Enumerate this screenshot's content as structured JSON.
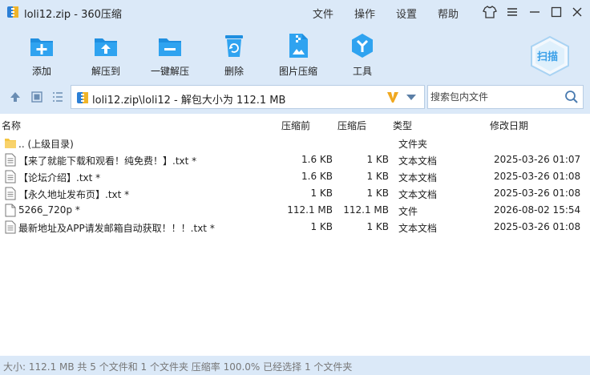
{
  "window": {
    "title": "loli12.zip - 360压缩",
    "menu": [
      "文件",
      "操作",
      "设置",
      "帮助"
    ]
  },
  "toolbar": {
    "items": [
      {
        "label": "添加",
        "icon": "add-icon"
      },
      {
        "label": "解压到",
        "icon": "extract-to-icon"
      },
      {
        "label": "一键解压",
        "icon": "one-click-extract-icon"
      },
      {
        "label": "删除",
        "icon": "delete-icon"
      },
      {
        "label": "图片压缩",
        "icon": "image-compress-icon"
      },
      {
        "label": "工具",
        "icon": "tools-icon"
      }
    ],
    "scan_label": "扫描"
  },
  "address": {
    "path": "loli12.zip\\loli12 - 解包大小为 112.1 MB"
  },
  "search": {
    "placeholder": "搜索包内文件"
  },
  "columns": {
    "name": "名称",
    "before": "压缩前",
    "after": "压缩后",
    "type": "类型",
    "modified": "修改日期"
  },
  "files": [
    {
      "name": ".. (上级目录)",
      "before": "",
      "after": "",
      "type": "文件夹",
      "modified": "",
      "kind": "folder"
    },
    {
      "name": "【来了就能下载和观看！纯免费！】.txt *",
      "before": "1.6 KB",
      "after": "1 KB",
      "type": "文本文档",
      "modified": "2025-03-26 01:07",
      "kind": "txt"
    },
    {
      "name": "【论坛介绍】.txt *",
      "before": "1.6 KB",
      "after": "1 KB",
      "type": "文本文档",
      "modified": "2025-03-26 01:08",
      "kind": "txt"
    },
    {
      "name": "【永久地址发布页】.txt *",
      "before": "1 KB",
      "after": "1 KB",
      "type": "文本文档",
      "modified": "2025-03-26 01:08",
      "kind": "txt"
    },
    {
      "name": "5266_720p *",
      "before": "112.1 MB",
      "after": "112.1 MB",
      "type": "文件",
      "modified": "2026-08-02 15:54",
      "kind": "file"
    },
    {
      "name": "最新地址及APP请发邮箱自动获取！！！.txt *",
      "before": "1 KB",
      "after": "1 KB",
      "type": "文本文档",
      "modified": "2025-03-26 01:08",
      "kind": "txt"
    }
  ],
  "status": {
    "text": "大小: 112.1 MB 共 5 个文件和 1 个文件夹 压缩率 100.0% 已经选择 1 个文件夹"
  },
  "colors": {
    "accent": "#1f8fe0",
    "background": "#dbe9f8",
    "folder": "#f5c542"
  }
}
